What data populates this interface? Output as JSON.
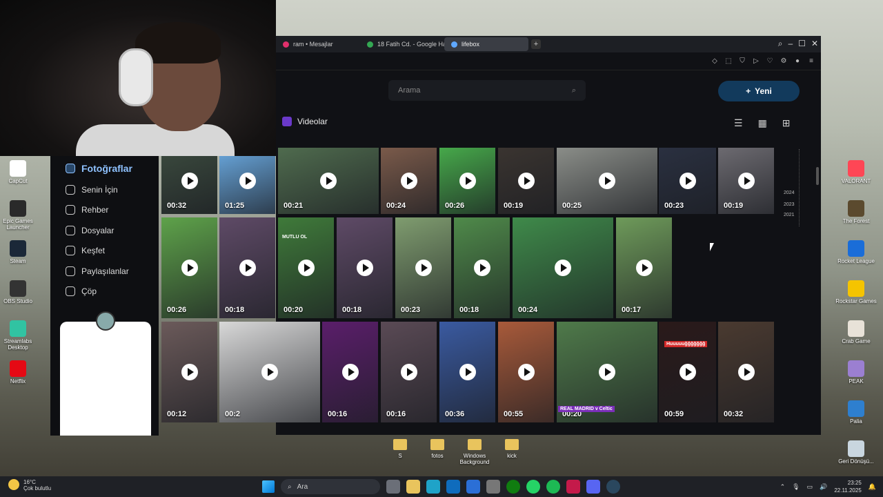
{
  "desktop": {
    "left_icons": [
      {
        "label": "CapCut",
        "color": "#ffffff"
      },
      {
        "label": "Epic Games Launcher",
        "color": "#2a2a2a"
      },
      {
        "label": "Steam",
        "color": "#1b2838"
      },
      {
        "label": "OBS Studio",
        "color": "#333333"
      },
      {
        "label": "Streamlabs Desktop",
        "color": "#31c3a2"
      },
      {
        "label": "Netflix",
        "color": "#e50914"
      }
    ],
    "right_icons": [
      {
        "label": "VALORANT",
        "color": "#ff4655"
      },
      {
        "label": "The Forest",
        "color": "#5b4a2e"
      },
      {
        "label": "Rocket League",
        "color": "#1a6dd8"
      },
      {
        "label": "Rockstar Games",
        "color": "#f5c400"
      },
      {
        "label": "Crab Game",
        "color": "#e8e2d8"
      },
      {
        "label": "PEAK",
        "color": "#9b7fd1"
      },
      {
        "label": "Palia",
        "color": "#2e7fcf"
      },
      {
        "label": "Geri Dönüşü...",
        "color": "#c9d6df"
      }
    ],
    "folders": [
      "S",
      "fotos",
      "Windows Background",
      "kick"
    ]
  },
  "browser": {
    "tabs": [
      {
        "label": "ram • Mesajlar",
        "active": false,
        "color": "#e1306c"
      },
      {
        "label": "18 Fatih Cd. - Google Har",
        "active": false,
        "color": "#34a853"
      },
      {
        "label": "lifebox",
        "active": true,
        "color": "#5fa8ff"
      }
    ],
    "search_placeholder": "Arama",
    "new_button": "Yeni",
    "section_title": "Videolar",
    "years": [
      "2024",
      "2023",
      "2021"
    ]
  },
  "sidenav": {
    "items": [
      {
        "label": "Fotoğraflar",
        "icon": "photos-icon",
        "active": true
      },
      {
        "label": "Senin İçin",
        "icon": "heart-icon",
        "active": false
      },
      {
        "label": "Rehber",
        "icon": "contacts-icon",
        "active": false
      },
      {
        "label": "Dosyalar",
        "icon": "files-icon",
        "active": false
      },
      {
        "label": "Keşfet",
        "icon": "compass-icon",
        "active": false
      },
      {
        "label": "Paylaşılanlar",
        "icon": "people-icon",
        "active": false
      },
      {
        "label": "Çöp",
        "icon": "trash-icon",
        "active": false
      }
    ]
  },
  "videos": {
    "row1": [
      {
        "duration": "00:32",
        "color": "#3b4a3e"
      },
      {
        "duration": "01:25",
        "color": "#6aa9e0"
      },
      {
        "duration": "00:21",
        "color": "#4f6b4e"
      },
      {
        "duration": "00:24",
        "color": "#7a5a4a"
      },
      {
        "duration": "00:26",
        "color": "#46a84a"
      },
      {
        "duration": "00:19",
        "color": "#3a3430"
      },
      {
        "duration": "00:25",
        "color": "#8a8d88"
      },
      {
        "duration": "00:23",
        "color": "#2a3040"
      },
      {
        "duration": "00:19",
        "color": "#6c6a70"
      }
    ],
    "row2": [
      {
        "duration": "00:26",
        "color": "#5ea24a"
      },
      {
        "duration": "00:18",
        "color": "#5e4a66"
      },
      {
        "duration": "00:20",
        "color": "#3f7a3a"
      },
      {
        "duration": "00:18",
        "color": "#5e4a66"
      },
      {
        "duration": "00:23",
        "color": "#7f9c6f"
      },
      {
        "duration": "00:18",
        "color": "#4f8a4a"
      },
      {
        "duration": "00:24",
        "color": "#3f8a4a"
      },
      {
        "duration": "00:17",
        "color": "#6e9a5a"
      }
    ],
    "row3": [
      {
        "duration": "00:12",
        "color": "#6b5a5a"
      },
      {
        "duration": "00:2",
        "color": "#d8d8d8"
      },
      {
        "duration": "00:16",
        "color": "#5a1e6a"
      },
      {
        "duration": "00:16",
        "color": "#5a4a55"
      },
      {
        "duration": "00:36",
        "color": "#3a5aa0"
      },
      {
        "duration": "00:55",
        "color": "#a85a3a"
      },
      {
        "duration": "00:20",
        "color": "#4f7a4a"
      },
      {
        "duration": "00:59",
        "color": "#2a1a1a"
      },
      {
        "duration": "00:32",
        "color": "#4a3a30"
      }
    ],
    "labels": {
      "mutlu": "MUTLU OL",
      "huu": "Huuuuuğğğğğğğ",
      "madrid": "REAL MADRID v Celtic"
    }
  },
  "taskbar": {
    "temp": "16°C",
    "weather": "Çok bulutlu",
    "search": "Ara",
    "time": "23:25",
    "date": "22.11.2025"
  }
}
